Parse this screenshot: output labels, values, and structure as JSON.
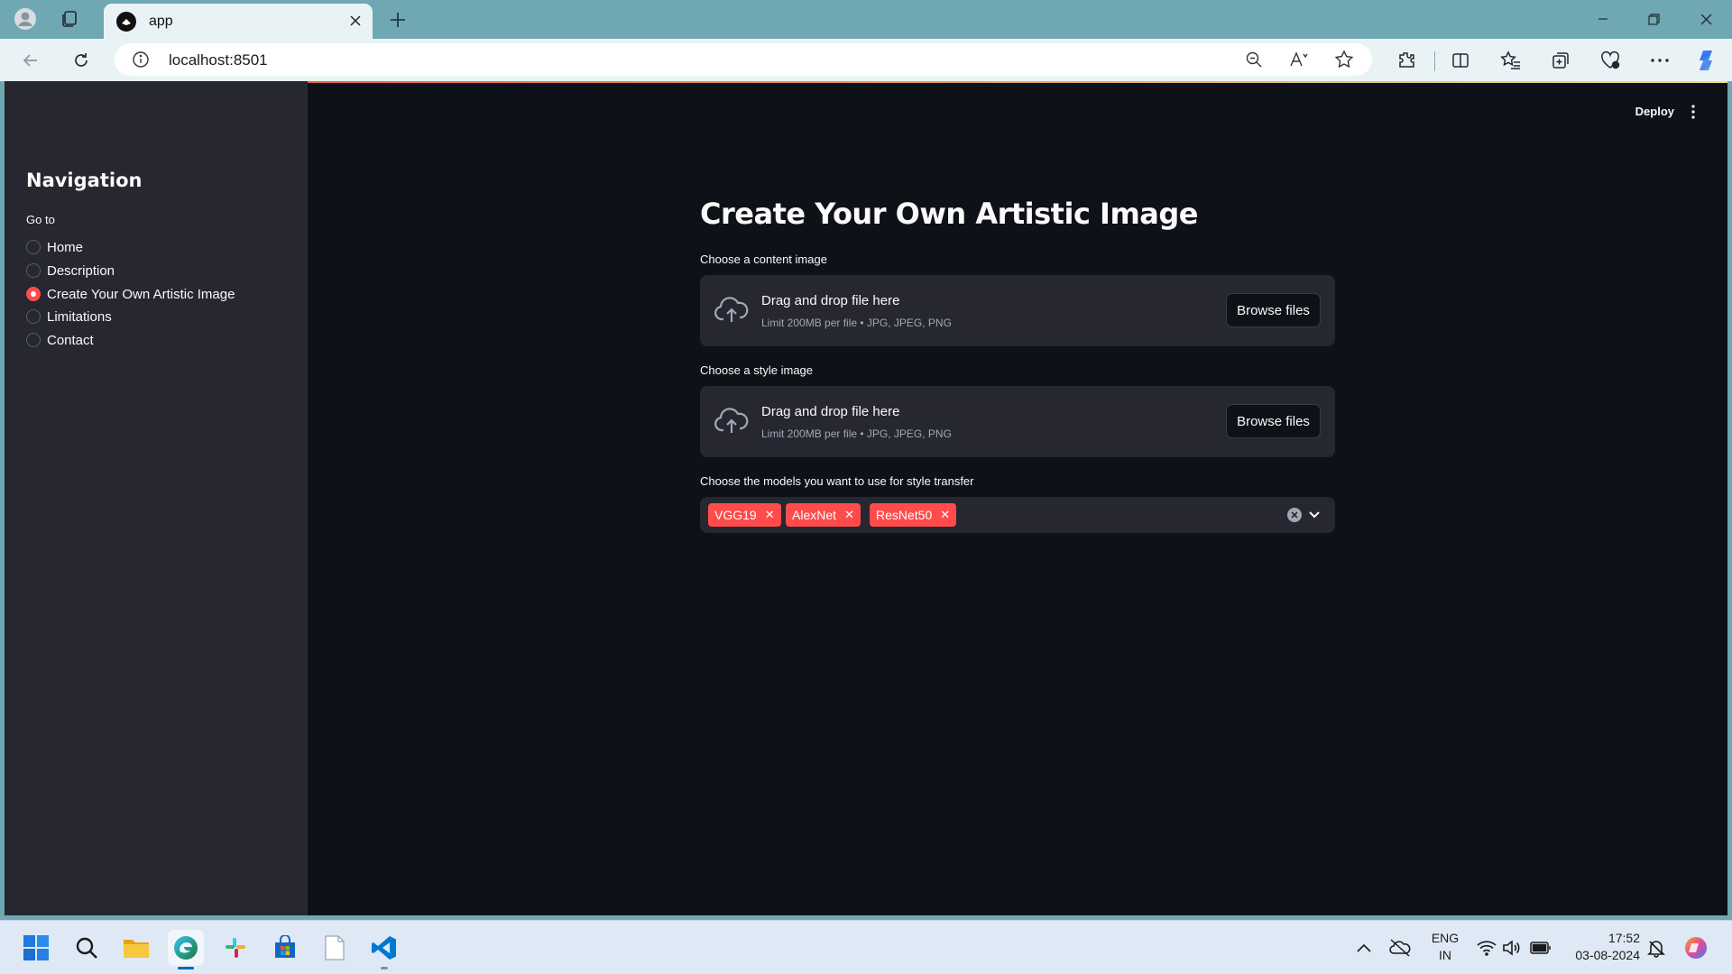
{
  "browser": {
    "tab_title": "app",
    "url": "localhost:8501"
  },
  "sidebar": {
    "title": "Navigation",
    "radio_label": "Go to",
    "items": [
      {
        "label": "Home",
        "selected": false
      },
      {
        "label": "Description",
        "selected": false
      },
      {
        "label": "Create Your Own Artistic Image",
        "selected": true
      },
      {
        "label": "Limitations",
        "selected": false
      },
      {
        "label": "Contact",
        "selected": false
      }
    ]
  },
  "header": {
    "deploy_label": "Deploy"
  },
  "main": {
    "title": "Create Your Own Artistic Image",
    "content_uploader": {
      "label": "Choose a content image",
      "drop_text": "Drag and drop file here",
      "limit_text": "Limit 200MB per file • JPG, JPEG, PNG",
      "button_label": "Browse files"
    },
    "style_uploader": {
      "label": "Choose a style image",
      "drop_text": "Drag and drop file here",
      "limit_text": "Limit 200MB per file • JPG, JPEG, PNG",
      "button_label": "Browse files"
    },
    "models": {
      "label": "Choose the models you want to use for style transfer",
      "selected": [
        "VGG19",
        "AlexNet",
        "ResNet50"
      ]
    }
  },
  "taskbar": {
    "lang_line1": "ENG",
    "lang_line2": "IN",
    "time": "17:52",
    "date": "03-08-2024"
  },
  "colors": {
    "accent": "#ff4b4b",
    "app_bg": "#0e1117",
    "sidebar_bg": "#262730"
  }
}
